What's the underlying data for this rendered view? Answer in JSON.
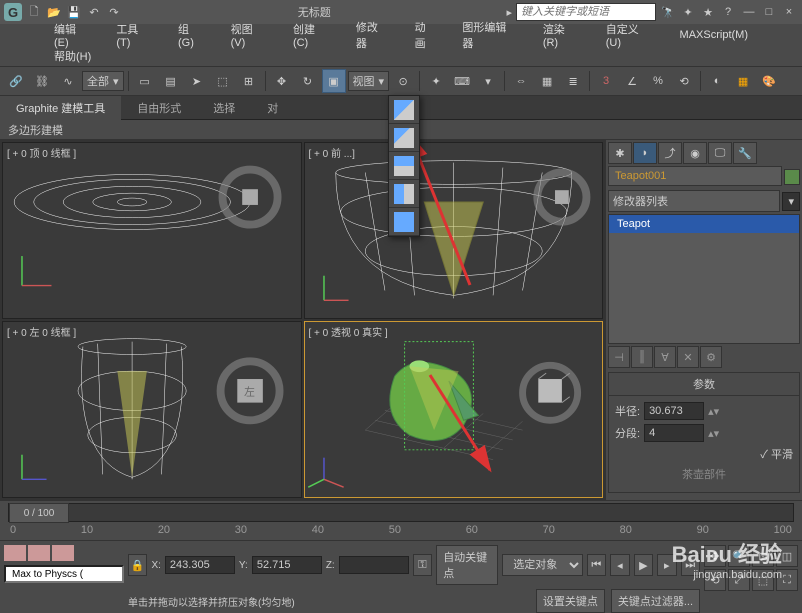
{
  "title": "无标题",
  "search_placeholder": "键入关键字或短语",
  "arrow_hint": "▸",
  "menus": {
    "edit": "编辑(E)",
    "tools": "工具(T)",
    "group": "组(G)",
    "views": "视图(V)",
    "create": "创建(C)",
    "modifiers": "修改器",
    "animation": "动画",
    "graph": "图形编辑器",
    "render": "渲染(R)",
    "customize": "自定义(U)",
    "maxscript": "MAXScript(M)",
    "help": "帮助(H)"
  },
  "toolbar": {
    "filter": "全部",
    "refcoord": "视图",
    "open_dd": "▾"
  },
  "ribbon": {
    "graphite": "Graphite 建模工具",
    "freeform": "自由形式",
    "selection": "选择",
    "object": "对",
    "sub": "多边形建模"
  },
  "viewports": {
    "top": "[ + 0 顶 0 线框 ]",
    "front": "[ + 0 前 ...]",
    "left": "[ + 0 左 0 线框 ]",
    "persp": "[ + 0 透视 0 真实 ]"
  },
  "command_panel": {
    "object_name": "Teapot001",
    "modifier_list": "修改器列表",
    "stack_item": "Teapot",
    "params": "参数",
    "radius_label": "半径:",
    "radius": "30.673",
    "segments_label": "分段:",
    "segments": "4",
    "smooth": "✓ 平滑",
    "teapot_parts": "茶壶部件"
  },
  "timeline": {
    "pos": "0 / 100",
    "ticks": [
      "0",
      "10",
      "20",
      "30",
      "40",
      "50",
      "60",
      "70",
      "80",
      "90",
      "100"
    ]
  },
  "status": {
    "script": "Max to Physcs (",
    "x_label": "X:",
    "x": "243.305",
    "y_label": "Y:",
    "y": "52.715",
    "z_label": "Z:",
    "autokey": "自动关键点",
    "setkey": "设置关键点",
    "selected": "选定对象",
    "keyfilter": "关键点过滤器...",
    "prompt": "单击并拖动以选择并挤压对象(均匀地)"
  },
  "icons": {
    "min": "—",
    "max": "□",
    "close": "×"
  }
}
